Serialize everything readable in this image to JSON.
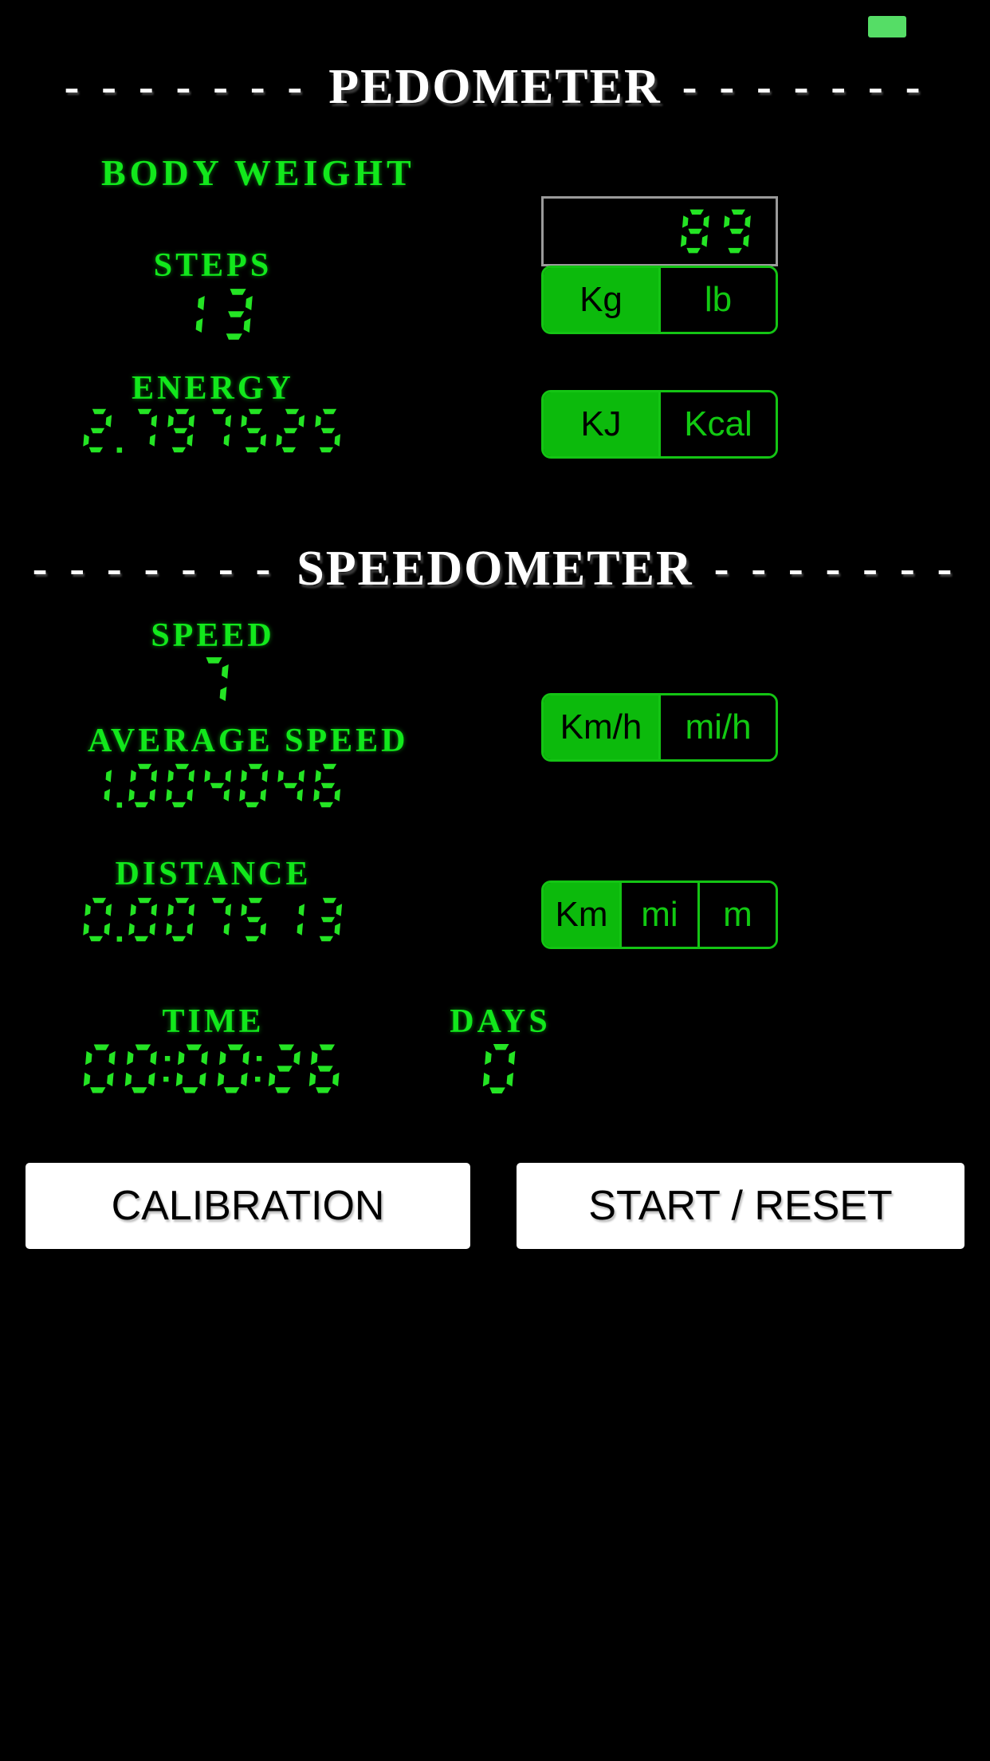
{
  "app": {
    "background_color": "#000000",
    "lcd_green": "#24e424",
    "label_green": "#12e81c",
    "accent_green": "#0cba0c",
    "status_indicator_color": "#55dd66"
  },
  "status_bar": {
    "indicator_name": "recording-indicator"
  },
  "pedometer": {
    "header_title": "PEDOMETER",
    "header_dashes_left": "- - - - - - -",
    "header_dashes_right": "- - - - - - -",
    "body_weight": {
      "label": "BODY WEIGHT",
      "value": "89",
      "units": [
        {
          "label": "Kg",
          "selected": true
        },
        {
          "label": "lb",
          "selected": false
        }
      ]
    },
    "steps": {
      "label": "STEPS",
      "value": "13"
    },
    "energy": {
      "label": "ENERGY",
      "value": "2.797525",
      "units": [
        {
          "label": "KJ",
          "selected": true
        },
        {
          "label": "Kcal",
          "selected": false
        }
      ]
    }
  },
  "speedometer": {
    "header_title": "SPEEDOMETER",
    "header_dashes_left": "- - - - - - -",
    "header_dashes_right": "- - - - - - -",
    "speed": {
      "label": "SPEED",
      "value": "7"
    },
    "average_speed": {
      "label": "AVERAGE SPEED",
      "value": "1.004046",
      "units": [
        {
          "label": "Km/h",
          "selected": true
        },
        {
          "label": "mi/h",
          "selected": false
        }
      ]
    },
    "distance": {
      "label": "DISTANCE",
      "value": "0.007513",
      "units": [
        {
          "label": "Km",
          "selected": true
        },
        {
          "label": "mi",
          "selected": false
        },
        {
          "label": "m",
          "selected": false
        }
      ]
    },
    "time": {
      "label": "TIME",
      "value": "00:00:26"
    },
    "days": {
      "label": "DAYS",
      "value": "0"
    }
  },
  "actions": {
    "calibration_label": "CALIBRATION",
    "start_reset_label": "START / RESET"
  }
}
